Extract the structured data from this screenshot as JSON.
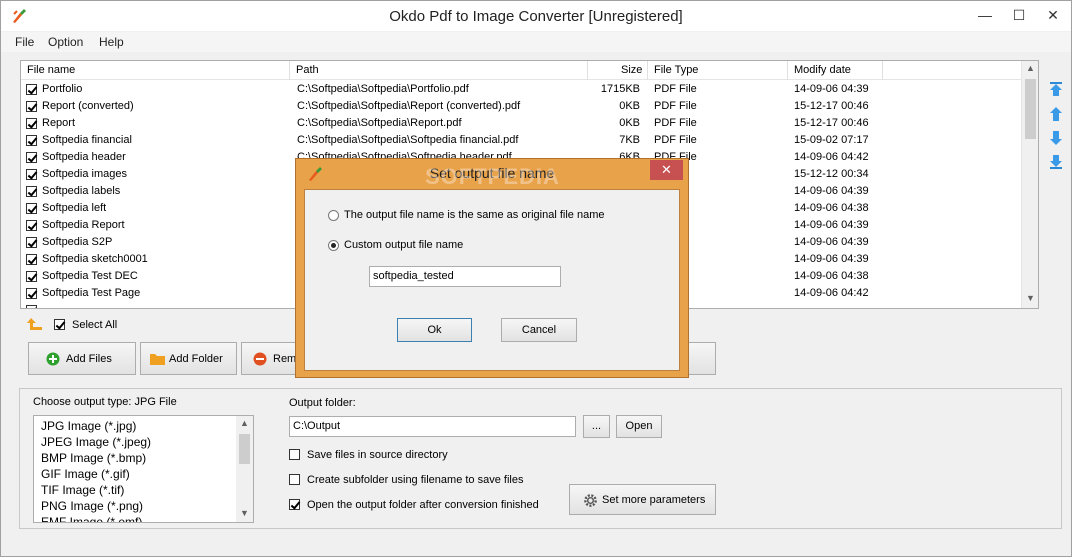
{
  "app": {
    "title": "Okdo Pdf to Image Converter [Unregistered]",
    "window_controls": [
      "—",
      "☐",
      "✕"
    ]
  },
  "menu": [
    "File",
    "Option",
    "Help"
  ],
  "file_list": {
    "columns": [
      "File name",
      "Path",
      "Size",
      "File Type",
      "Modify date"
    ],
    "rows": [
      {
        "name": "Portfolio",
        "path": "C:\\Softpedia\\Softpedia\\Portfolio.pdf",
        "size": "1715KB",
        "type": "PDF File",
        "date": "14-09-06 04:39"
      },
      {
        "name": "Report (converted)",
        "path": "C:\\Softpedia\\Softpedia\\Report (converted).pdf",
        "size": "0KB",
        "type": "PDF File",
        "date": "15-12-17 00:46"
      },
      {
        "name": "Report",
        "path": "C:\\Softpedia\\Softpedia\\Report.pdf",
        "size": "0KB",
        "type": "PDF File",
        "date": "15-12-17 00:46"
      },
      {
        "name": "Softpedia financial",
        "path": "C:\\Softpedia\\Softpedia\\Softpedia financial.pdf",
        "size": "7KB",
        "type": "PDF File",
        "date": "15-09-02 07:17"
      },
      {
        "name": "Softpedia header",
        "path": "C:\\Softpedia\\Softpedia\\Softpedia header.pdf",
        "size": "6KB",
        "type": "PDF File",
        "date": "14-09-06 04:42"
      },
      {
        "name": "Softpedia images",
        "path": "",
        "size": "",
        "type": "",
        "date": "15-12-12 00:34"
      },
      {
        "name": "Softpedia labels",
        "path": "",
        "size": "",
        "type": "",
        "date": "14-09-06 04:39"
      },
      {
        "name": "Softpedia left",
        "path": "",
        "size": "",
        "type": "",
        "date": "14-09-06 04:38"
      },
      {
        "name": "Softpedia Report",
        "path": "",
        "size": "",
        "type": "",
        "date": "14-09-06 04:39"
      },
      {
        "name": "Softpedia S2P",
        "path": "",
        "size": "",
        "type": "",
        "date": "14-09-06 04:39"
      },
      {
        "name": "Softpedia sketch0001",
        "path": "",
        "size": "",
        "type": "",
        "date": "14-09-06 04:39"
      },
      {
        "name": "Softpedia Test DEC",
        "path": "",
        "size": "",
        "type": "",
        "date": "14-09-06 04:38"
      },
      {
        "name": "Softpedia Test Page",
        "path": "",
        "size": "",
        "type": "",
        "date": "14-09-06 04:42"
      }
    ]
  },
  "select_all_label": "Select All",
  "buttons": {
    "add_files": "Add Files",
    "add_folder": "Add Folder",
    "remove": "Remo"
  },
  "output": {
    "type_label": "Choose output type:  JPG File",
    "types": [
      "JPG Image (*.jpg)",
      "JPEG Image (*.jpeg)",
      "BMP Image (*.bmp)",
      "GIF Image (*.gif)",
      "TIF Image (*.tif)",
      "PNG Image (*.png)",
      "EMF Image (*.emf)"
    ],
    "folder_label": "Output folder:",
    "folder_value": "C:\\Output",
    "browse": "...",
    "open": "Open",
    "save_in_source": "Save files in source directory",
    "create_subfolder": "Create subfolder using filename to save files",
    "open_after": "Open the output folder after conversion finished",
    "set_more": "Set more parameters"
  },
  "dialog": {
    "title": "Set output file name",
    "close": "✕",
    "option_same": "The output file name is the same as original file name",
    "option_custom": "Custom output file name",
    "custom_value": "softpedia_tested",
    "ok": "Ok",
    "cancel": "Cancel",
    "watermark": "SOFTPEDIA"
  }
}
